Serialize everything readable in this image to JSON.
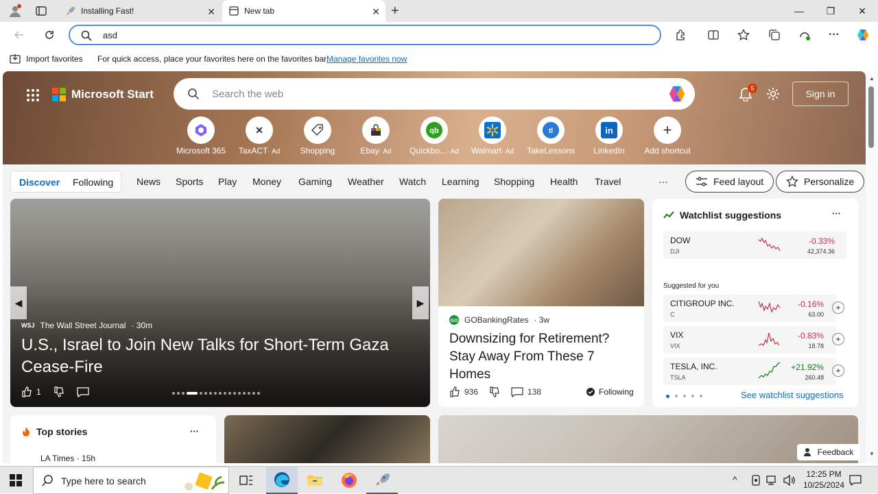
{
  "browser": {
    "tabs": [
      {
        "title": "Installing Fast!",
        "close": "✕"
      },
      {
        "title": "New tab",
        "close": "✕"
      }
    ],
    "new_tab": "+",
    "window_controls": {
      "minimize": "—",
      "restore": "❐",
      "close": "✕"
    },
    "address_value": "asd",
    "favorites_bar": {
      "import_label": "Import favorites",
      "message": "For quick access, place your favorites here on the favorites bar.",
      "manage_link": "Manage favorites now"
    }
  },
  "page": {
    "brand": "Microsoft Start",
    "search_placeholder": "Search the web",
    "notifications_count": "5",
    "sign_in": "Sign in",
    "shortcuts": [
      {
        "label": "Microsoft 365",
        "ad": "",
        "icon": "m365-icon",
        "color": "#7b61ff"
      },
      {
        "label": "TaxACT",
        "ad": "· Ad",
        "icon": "taxact-icon",
        "color": "#1e2a4a"
      },
      {
        "label": "Shopping",
        "ad": "",
        "icon": "shopping-tag-icon",
        "color": "#444444"
      },
      {
        "label": "Ebay",
        "ad": "· Ad",
        "icon": "ebay-icon",
        "color": "#e53238"
      },
      {
        "label": "Quickbo...",
        "ad": "· Ad",
        "icon": "quickbooks-icon",
        "color": "#2ca01c"
      },
      {
        "label": "Walmart",
        "ad": "· Ad",
        "icon": "walmart-icon",
        "color": "#0071ce"
      },
      {
        "label": "TakeLessons",
        "ad": "",
        "icon": "takelessons-icon",
        "color": "#2b7bd6"
      },
      {
        "label": "LinkedIn",
        "ad": "",
        "icon": "linkedin-icon",
        "color": "#0a66c2"
      },
      {
        "label": "Add shortcut",
        "ad": "",
        "icon": "plus-icon",
        "color": "#333333"
      }
    ],
    "feed_tabs": {
      "discover": "Discover",
      "following": "Following"
    },
    "nav": [
      "News",
      "Sports",
      "Play",
      "Money",
      "Gaming",
      "Weather",
      "Watch",
      "Learning",
      "Shopping",
      "Health",
      "Travel"
    ],
    "more": "···",
    "feed_layout": "Feed layout",
    "personalize": "Personalize",
    "hero_story": {
      "source_badge": "WSJ",
      "source": "The Wall Street Journal",
      "age": "· 30m",
      "headline": "U.S., Israel to Join New Talks for Short-Term Gaza Cease-Fire",
      "likes": "1"
    },
    "story2": {
      "source": "GOBankingRates",
      "age": "· 3w",
      "headline": "Downsizing for Retirement? Stay Away From These 7 Homes",
      "likes": "936",
      "comments": "138",
      "following": "Following"
    },
    "watchlist": {
      "title": "Watchlist suggestions",
      "more": "···",
      "main": {
        "name": "DOW",
        "ticker": "DJI",
        "change": "-0.33%",
        "price": "42,374.36"
      },
      "suggested_label": "Suggested for you",
      "suggested": [
        {
          "name": "CITIGROUP INC.",
          "ticker": "C",
          "change": "-0.16%",
          "price": "63.00"
        },
        {
          "name": "VIX",
          "ticker": "VIX",
          "change": "-0.83%",
          "price": "18.78"
        },
        {
          "name": "TESLA, INC.",
          "ticker": "TSLA",
          "change": "+21.92%",
          "price": "260.48"
        }
      ],
      "see_more": "See watchlist suggestions"
    },
    "top_stories": {
      "title": "Top stories",
      "more": "···",
      "first_source": "LA Times · 15h"
    },
    "feedback": "Feedback"
  },
  "taskbar": {
    "search_placeholder": "Type here to search",
    "time": "12:25 PM",
    "date": "10/25/2024"
  },
  "colors": {
    "accent": "#0f6cbd",
    "negative": "#c4314b",
    "positive": "#107c10"
  }
}
